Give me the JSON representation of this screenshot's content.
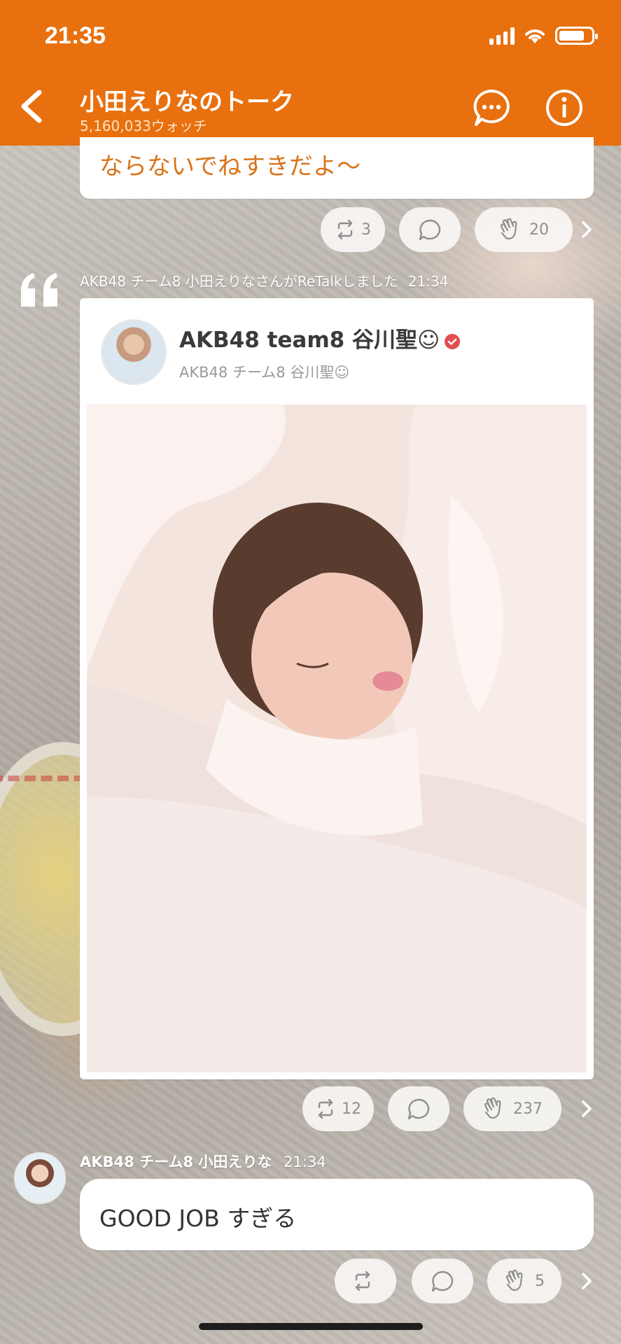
{
  "status_bar": {
    "time": "21:35"
  },
  "header": {
    "title": "小田えりなのトーク",
    "subtitle": "5,160,033ウォッチ"
  },
  "colors": {
    "brand_orange": "#e8700e",
    "message_text_orange": "#d9731a",
    "verified_red": "#e34e4e"
  },
  "messages": [
    {
      "id": "top",
      "text": "ならないでねすきだよ〜",
      "actions": {
        "retalk_count": "3",
        "comment_count": "",
        "applause_count": "20"
      }
    },
    {
      "id": "retalk",
      "meta": "AKB48 チーム8 小田えりなさんがReTalkしました",
      "time": "21:34",
      "author_name": "AKB48 team8 谷川聖☺",
      "author_sub": "AKB48 チーム8 谷川聖☺",
      "photo_alt": "sleeping-girl-photo",
      "actions": {
        "retalk_count": "12",
        "comment_count": "",
        "applause_count": "237"
      }
    },
    {
      "id": "bottom",
      "sender": "AKB48 チーム8 小田えりな",
      "time": "21:34",
      "text": "GOOD JOB すぎる",
      "actions": {
        "retalk_count": "",
        "comment_count": "",
        "applause_count": "5"
      }
    }
  ],
  "icons": [
    "back-chevron-icon",
    "chat-bubble-icon",
    "info-icon",
    "retalk-icon",
    "comment-icon",
    "applause-icon",
    "chevron-right-icon",
    "quote-icon",
    "verified-icon"
  ]
}
